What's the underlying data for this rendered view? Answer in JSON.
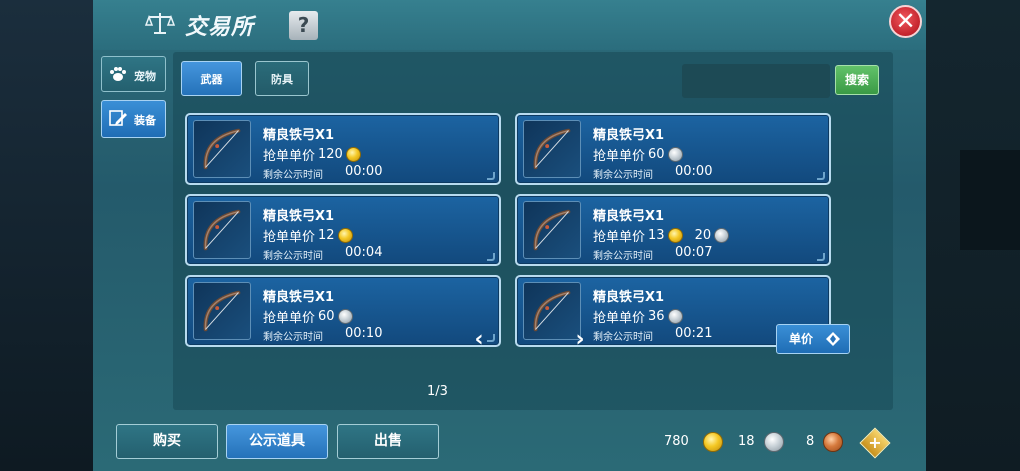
{
  "window": {
    "title": "交易所",
    "help": "?",
    "close": "✕"
  },
  "side_tabs": [
    {
      "label": "宠物",
      "icon": "paw-icon",
      "active": false
    },
    {
      "label": "装备",
      "icon": "pencil-icon",
      "active": true
    }
  ],
  "top_tabs": [
    {
      "label": "武器",
      "active": true
    },
    {
      "label": "防具",
      "active": false
    }
  ],
  "search": {
    "value": "",
    "placeholder": "",
    "button_label": "搜索"
  },
  "cards": [
    {
      "name": "精良铁弓X1",
      "price_label": "抢单单价",
      "prices": [
        {
          "amount": "120",
          "coin": "gold"
        }
      ],
      "time_label": "剩余公示时间",
      "time": "00:00"
    },
    {
      "name": "精良铁弓X1",
      "price_label": "抢单单价",
      "prices": [
        {
          "amount": "60",
          "coin": "silver"
        }
      ],
      "time_label": "剩余公示时间",
      "time": "00:00"
    },
    {
      "name": "精良铁弓X1",
      "price_label": "抢单单价",
      "prices": [
        {
          "amount": "12",
          "coin": "gold"
        }
      ],
      "time_label": "剩余公示时间",
      "time": "00:04"
    },
    {
      "name": "精良铁弓X1",
      "price_label": "抢单单价",
      "prices": [
        {
          "amount": "13",
          "coin": "gold"
        },
        {
          "amount": "20",
          "coin": "silver"
        }
      ],
      "time_label": "剩余公示时间",
      "time": "00:07"
    },
    {
      "name": "精良铁弓X1",
      "price_label": "抢单单价",
      "prices": [
        {
          "amount": "60",
          "coin": "silver"
        }
      ],
      "time_label": "剩余公示时间",
      "time": "00:10"
    },
    {
      "name": "精良铁弓X1",
      "price_label": "抢单单价",
      "prices": [
        {
          "amount": "36",
          "coin": "silver"
        }
      ],
      "time_label": "剩余公示时间",
      "time": "00:21"
    }
  ],
  "pager": {
    "text": "1/3",
    "prev": "‹",
    "next": "›"
  },
  "sort_button": {
    "label": "单价"
  },
  "bottom_tabs": [
    {
      "label": "购买",
      "active": false
    },
    {
      "label": "公示道具",
      "active": true
    },
    {
      "label": "出售",
      "active": false
    }
  ],
  "currencies": [
    {
      "amount": "780",
      "coin": "gold"
    },
    {
      "amount": "18",
      "coin": "silver"
    },
    {
      "amount": "8",
      "coin": "copper"
    }
  ],
  "add_button": "+",
  "colors": {
    "accent_blue": "#2572b9",
    "panel_teal": "#2b6a76",
    "search_green": "#3a9a45",
    "close_red": "#c3232c"
  }
}
